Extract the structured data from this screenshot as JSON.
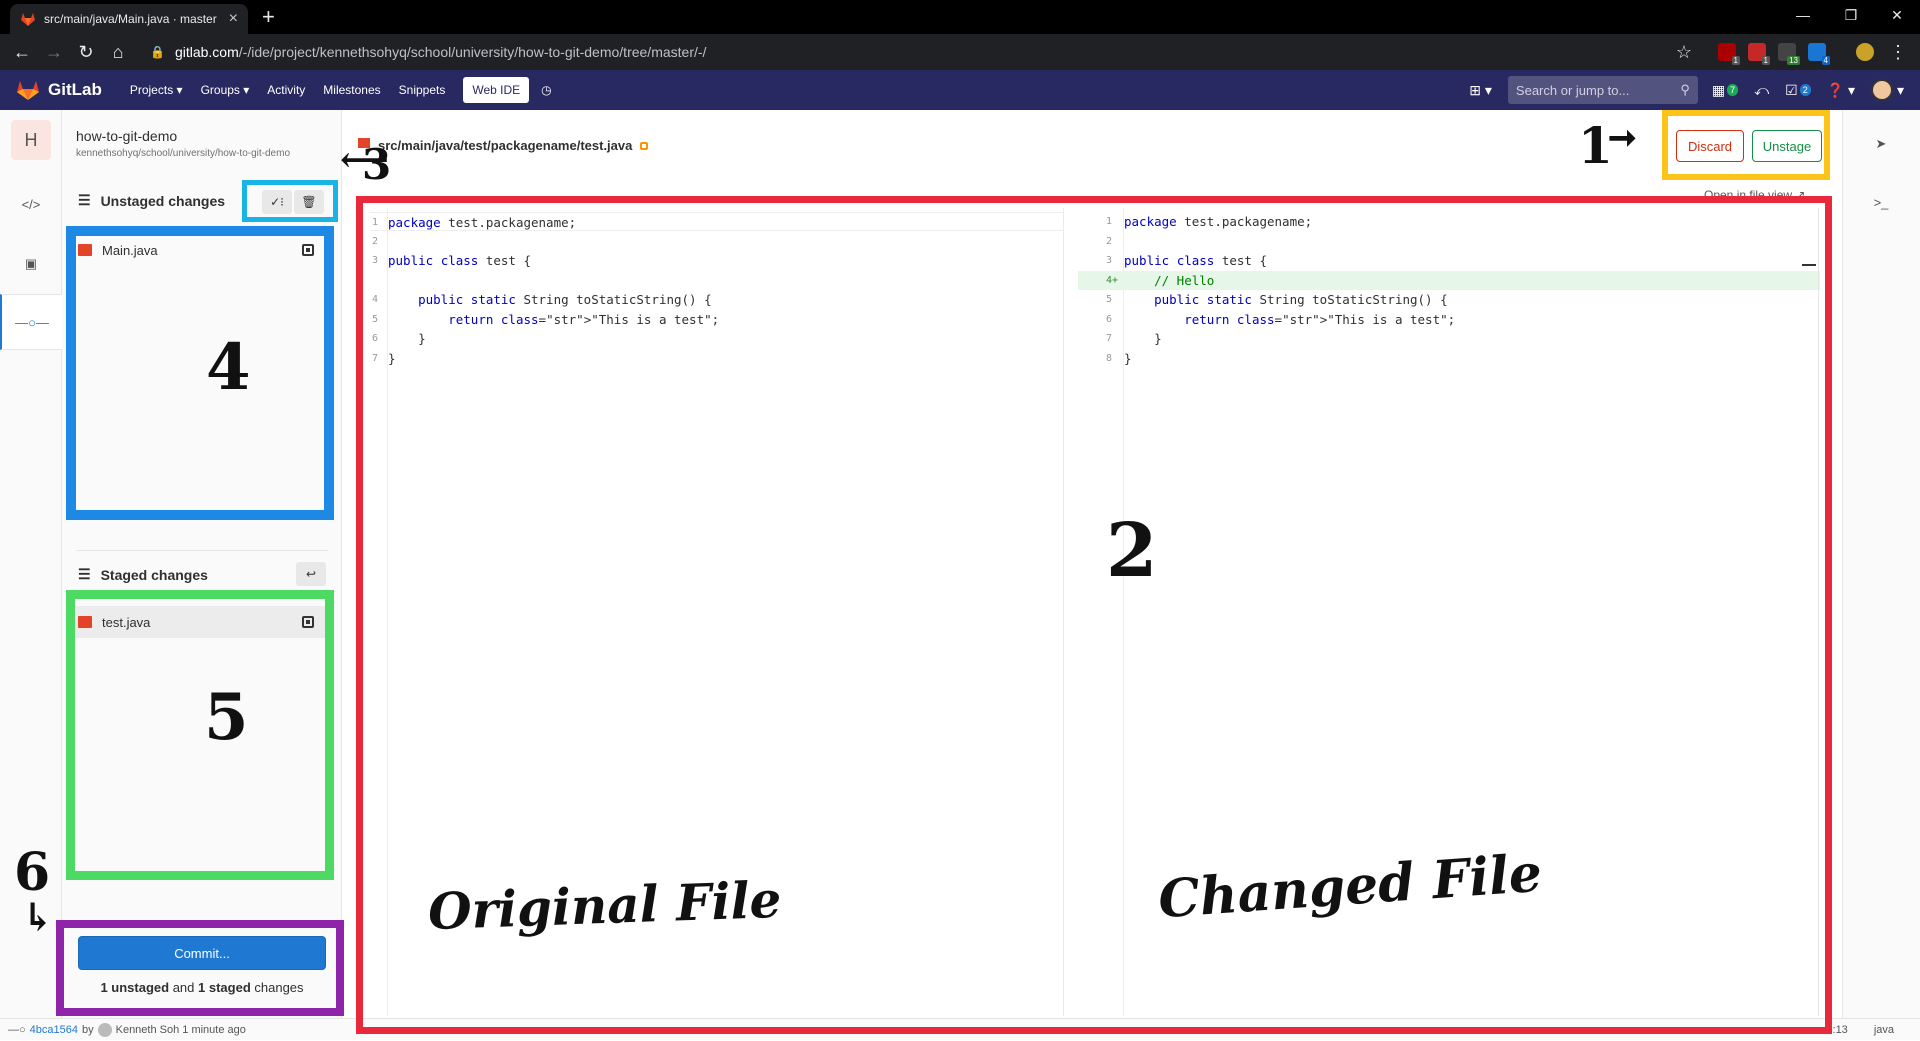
{
  "browser": {
    "tab_title": "src/main/java/Main.java · master",
    "tab_close": "×",
    "new_tab": "+",
    "url_host": "gitlab.com",
    "url_path": "/-/ide/project/kennethsohyq/school/university/how-to-git-demo/tree/master/-/",
    "ext_badges": [
      "1",
      "1",
      "13",
      "4"
    ]
  },
  "gitlab_header": {
    "brand": "GitLab",
    "nav": [
      "Projects",
      "Groups",
      "Activity",
      "Milestones",
      "Snippets"
    ],
    "web_ide": "Web IDE",
    "search_placeholder": "Search or jump to...",
    "mr_count": "7",
    "todo_count": "2"
  },
  "project": {
    "avatar_letter": "H",
    "name": "how-to-git-demo",
    "path": "kennethsohyq/school/university/how-to-git-demo"
  },
  "unstaged": {
    "title": "Unstaged changes",
    "files": [
      "Main.java"
    ]
  },
  "staged": {
    "title": "Staged changes",
    "files": [
      "test.java"
    ]
  },
  "commit": {
    "button": "Commit...",
    "summary_unstaged": "1 unstaged",
    "summary_and": "and",
    "summary_staged": "1 staged",
    "summary_changes": "changes"
  },
  "editor": {
    "file_path": "src/main/java/test/packagename/test.java",
    "discard": "Discard",
    "unstage": "Unstage",
    "open_in_file_view": "Open in file view",
    "original": [
      {
        "ln": "1",
        "code": "package test.packagename;"
      },
      {
        "ln": "2",
        "code": ""
      },
      {
        "ln": "3",
        "code": "public class test {"
      },
      {
        "ln": "",
        "code": ""
      },
      {
        "ln": "4",
        "code": "    public static String toStaticString() {"
      },
      {
        "ln": "5",
        "code": "        return \"This is a test\";"
      },
      {
        "ln": "6",
        "code": "    }"
      },
      {
        "ln": "7",
        "code": "}"
      }
    ],
    "modified": [
      {
        "ln": "1",
        "code": "package test.packagename;"
      },
      {
        "ln": "2",
        "code": ""
      },
      {
        "ln": "3",
        "code": "public class test {"
      },
      {
        "ln": "4+",
        "code": "    // Hello"
      },
      {
        "ln": "5",
        "code": "    public static String toStaticString() {"
      },
      {
        "ln": "6",
        "code": "        return \"This is a test\";"
      },
      {
        "ln": "7",
        "code": "    }"
      },
      {
        "ln": "8",
        "code": "}"
      }
    ]
  },
  "status_bar": {
    "commit_sha": "4bca1564",
    "by": "by",
    "author_time": "Kenneth Soh 1 minute ago",
    "position": "4:13",
    "language": "java"
  },
  "annotations": {
    "n1": "1",
    "n2": "2",
    "n3": "3",
    "n4": "4",
    "n5": "5",
    "n6": "6",
    "original_file": "Original File",
    "changed_file": "Changed File",
    "colors": {
      "box1": "#fcc419",
      "box2": "#e8283b",
      "box3": "#1ab3e6",
      "box4": "#1e88e5",
      "box5": "#4cd964",
      "box6": "#8e24aa"
    }
  }
}
